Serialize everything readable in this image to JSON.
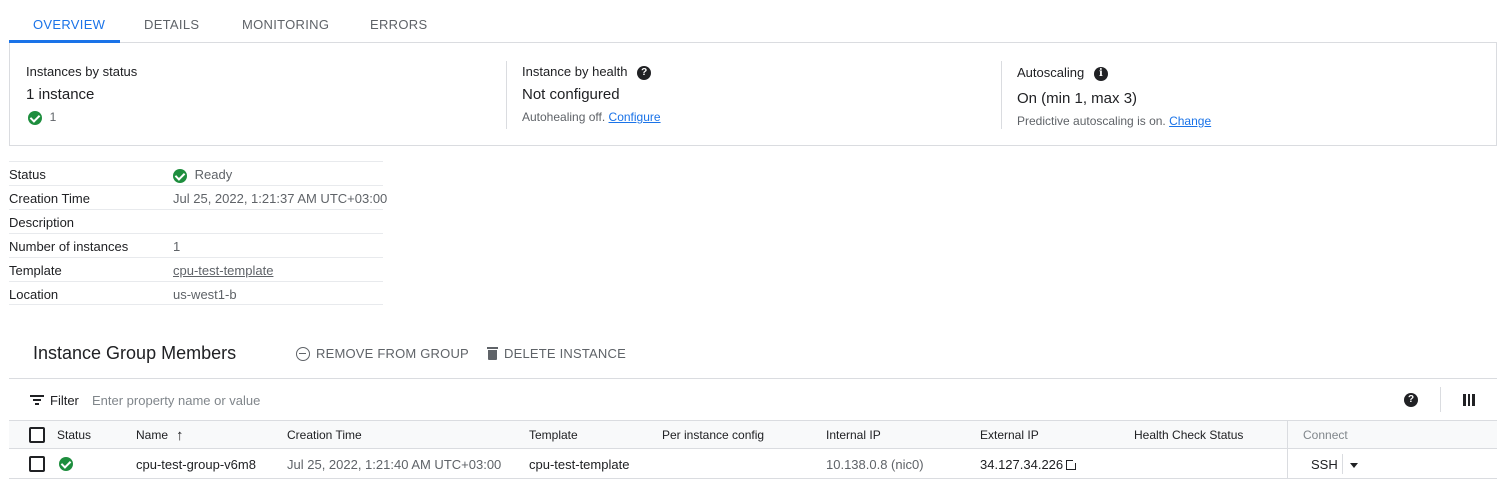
{
  "tabs": [
    "OVERVIEW",
    "DETAILS",
    "MONITORING",
    "ERRORS"
  ],
  "summary": {
    "status": {
      "title": "Instances by status",
      "value": "1 instance",
      "ready_count": "1"
    },
    "health": {
      "title": "Instance by health",
      "value": "Not configured",
      "sub": "Autohealing off.",
      "link": "Configure"
    },
    "autoscaling": {
      "title": "Autoscaling",
      "value": "On (min 1, max 3)",
      "sub": "Predictive autoscaling is on.",
      "link": "Change"
    }
  },
  "details": {
    "status_label": "Status",
    "status_value": "Ready",
    "creation_label": "Creation Time",
    "creation_value": "Jul 25, 2022, 1:21:37 AM UTC+03:00",
    "description_label": "Description",
    "description_value": "",
    "instances_label": "Number of instances",
    "instances_value": "1",
    "template_label": "Template",
    "template_value": "cpu-test-template",
    "location_label": "Location",
    "location_value": "us-west1-b"
  },
  "members": {
    "title": "Instance Group Members",
    "remove_label": "REMOVE FROM GROUP",
    "delete_label": "DELETE INSTANCE",
    "filter_label": "Filter",
    "filter_placeholder": "Enter property name or value",
    "columns": {
      "status": "Status",
      "name": "Name",
      "creation": "Creation Time",
      "template": "Template",
      "per_instance": "Per instance config",
      "internal_ip": "Internal IP",
      "external_ip": "External IP",
      "health_check": "Health Check Status",
      "connect": "Connect"
    },
    "rows": [
      {
        "name": "cpu-test-group-v6m8",
        "creation": "Jul 25, 2022, 1:21:40 AM UTC+03:00",
        "template": "cpu-test-template",
        "per_instance": "",
        "internal_ip": "10.138.0.8 (nic0)",
        "external_ip": "34.127.34.226",
        "health_check": "",
        "connect": "SSH"
      }
    ]
  },
  "colors": {
    "accent": "#1a73e8",
    "success": "#1e8e3e",
    "border": "#dadce0"
  },
  "icons": [
    "help-icon",
    "info-icon",
    "check-circle-icon",
    "minus-circle-icon",
    "trash-icon",
    "filter-icon",
    "columns-icon",
    "external-link-icon",
    "caret-down-icon",
    "sort-up-icon"
  ]
}
